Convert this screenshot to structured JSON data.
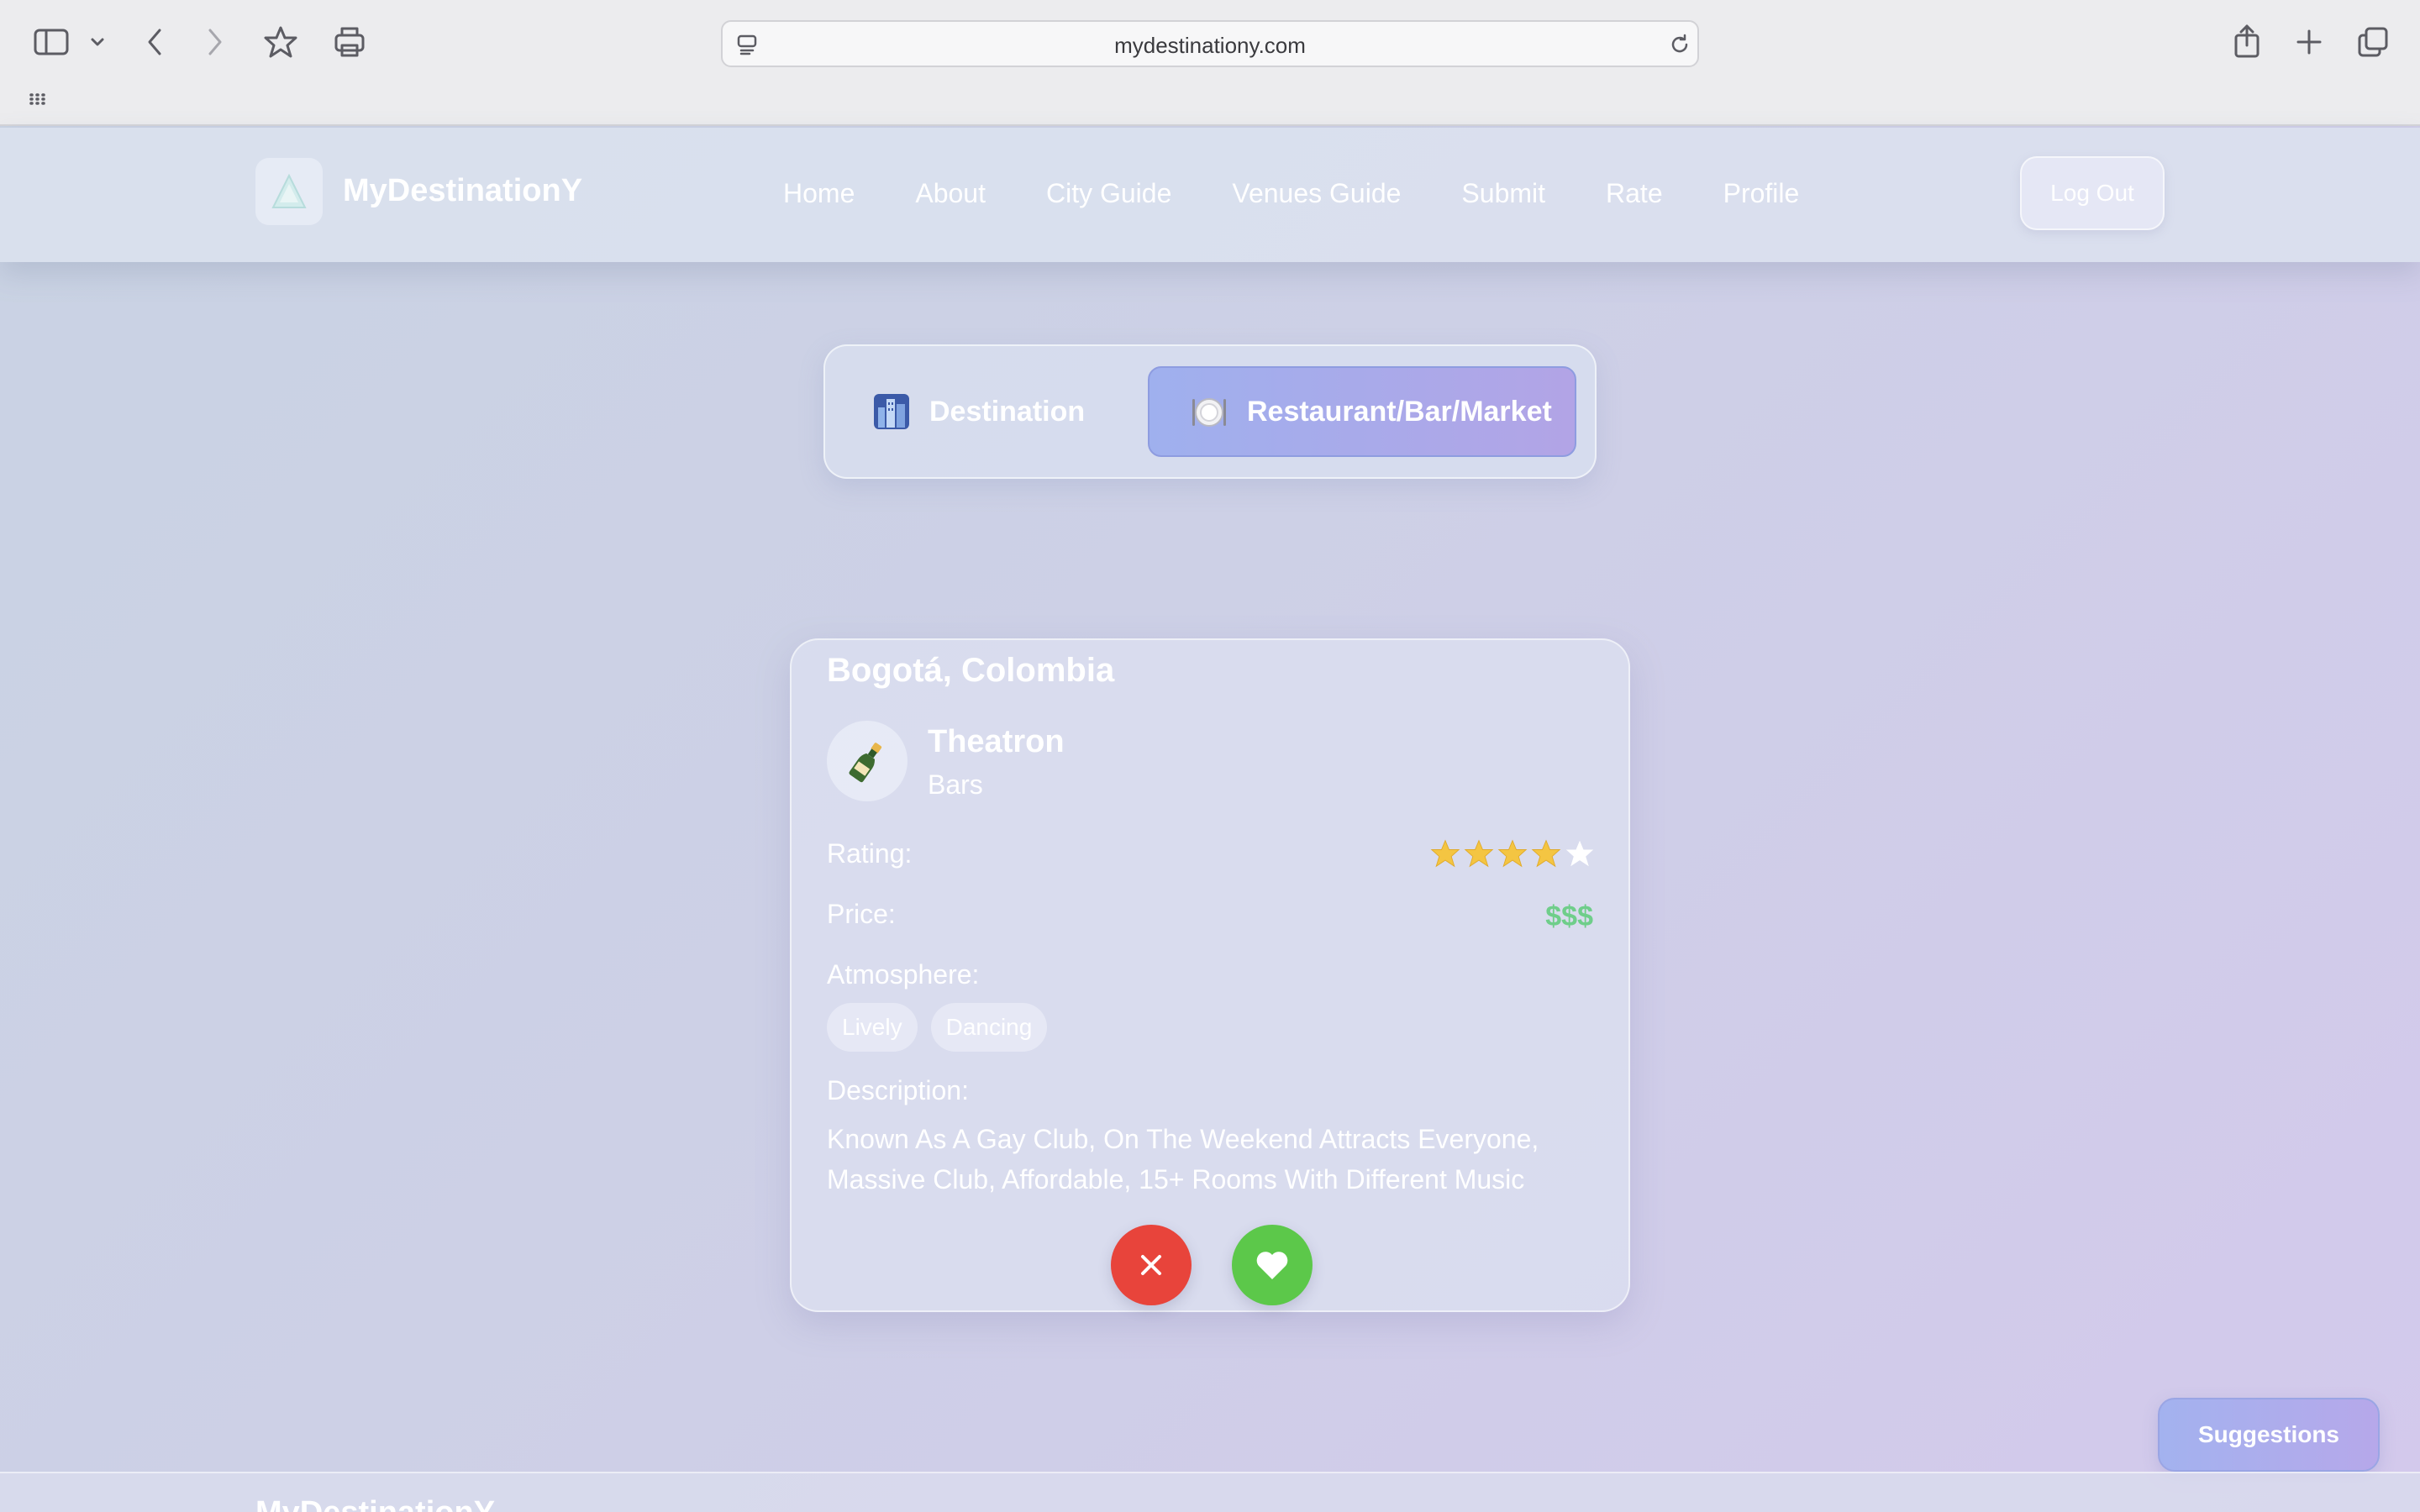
{
  "browser": {
    "url": "mydestinationy.com"
  },
  "header": {
    "brand": "MyDestinationY",
    "nav": [
      "Home",
      "About",
      "City Guide",
      "Venues Guide",
      "Submit",
      "Rate",
      "Profile"
    ],
    "logout_label": "Log Out"
  },
  "toggle": {
    "destination_label": "Destination",
    "venue_label": "Restaurant/Bar/Market",
    "active": "Restaurant/Bar/Market"
  },
  "card": {
    "city": "Bogotá, Colombia",
    "venue_name": "Theatron",
    "venue_category": "Bars",
    "venue_icon": "champagne-bottle-icon",
    "rating_label": "Rating:",
    "rating": 4,
    "rating_max": 5,
    "price_label": "Price:",
    "price": "$$$",
    "atmosphere_label": "Atmosphere:",
    "atmosphere_tags": [
      "Lively",
      "Dancing"
    ],
    "description_label": "Description:",
    "description": "Known As A Gay Club, On The Weekend Attracts Everyone, Massive Club, Affordable, 15+ Rooms With Different Music"
  },
  "suggestions_label": "Suggestions",
  "footer": {
    "brand": "MyDestinationY"
  },
  "colors": {
    "reject": "#e8443b",
    "like": "#5cc84a",
    "star_filled": "#f4c542",
    "price": "#6fce8a"
  }
}
